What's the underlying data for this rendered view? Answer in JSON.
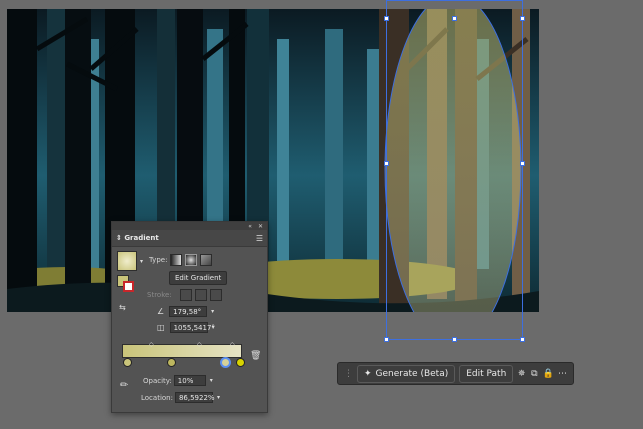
{
  "panel": {
    "title": "Gradient",
    "collapse_icon": "double-chevron-icon",
    "close_icon": "close-icon",
    "menu_icon": "hamburger-icon",
    "type_label": "Type:",
    "edit_gradient_label": "Edit Gradient",
    "stroke_label": "Stroke:",
    "angle_value": "179,58°",
    "aspect_value": "1055,5417°",
    "opacity_label": "Opacity:",
    "opacity_value": "10%",
    "location_label": "Location:",
    "location_value": "86,5922%",
    "gradient_start_color": "#c9c47a",
    "gradient_end_color": "#e6e3c4"
  },
  "toolbar": {
    "generate_label": "Generate (Beta)",
    "edit_path_label": "Edit Path"
  },
  "colors": {
    "canvas_bg": "#6b6b6b",
    "selection": "#3d6fe0",
    "glow": "#c7c07a"
  }
}
